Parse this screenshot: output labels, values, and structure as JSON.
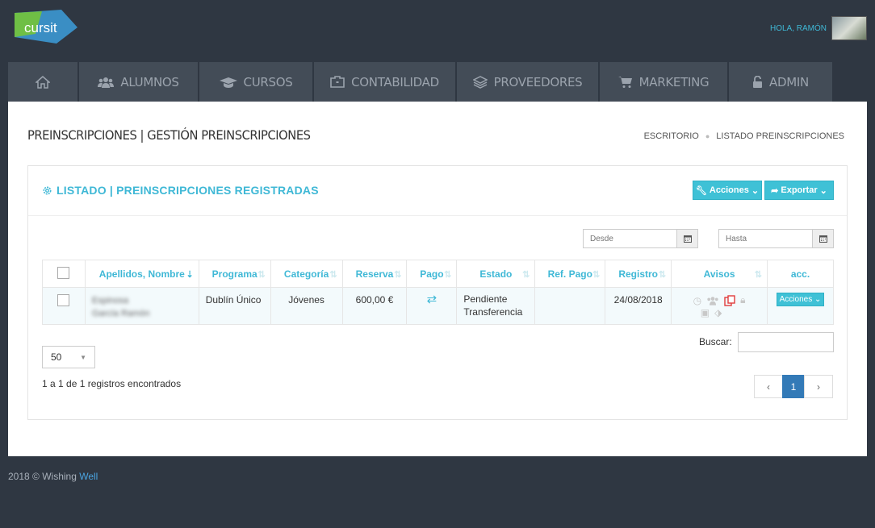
{
  "header": {
    "greeting": "HOLA, RAMÓN",
    "logo_text": "cursit"
  },
  "nav": [
    {
      "label": "",
      "icon": "home-icon"
    },
    {
      "label": "ALUMNOS",
      "icon": "users-icon"
    },
    {
      "label": "CURSOS",
      "icon": "graduation-cap-icon"
    },
    {
      "label": "CONTABILIDAD",
      "icon": "briefcase-icon"
    },
    {
      "label": "PROVEEDORES",
      "icon": "layers-icon"
    },
    {
      "label": "MARKETING",
      "icon": "cart-icon"
    },
    {
      "label": "ADMIN",
      "icon": "lock-icon"
    }
  ],
  "page": {
    "title": "PREINSCRIPCIONES | GESTIÓN PREINSCRIPCIONES",
    "breadcrumb": [
      "ESCRITORIO",
      "LISTADO PREINSCRIPCIONES"
    ]
  },
  "panel": {
    "title": "LISTADO | PREINSCRIPCIONES REGISTRADAS",
    "actions_label": "Acciones",
    "export_label": "Exportar"
  },
  "filters": {
    "from_placeholder": "Desde",
    "to_placeholder": "Hasta"
  },
  "table": {
    "headers": [
      "Apellidos, Nombre",
      "Programa",
      "Categoría",
      "Reserva",
      "Pago",
      "Estado",
      "Ref. Pago",
      "Registro",
      "Avisos",
      "acc."
    ],
    "rows": [
      {
        "name_line1": "Espinosa",
        "name_line2": "García Ramón",
        "programa": "Dublín Único",
        "categoria": "Jóvenes",
        "reserva": "600,00 €",
        "estado": "Pendiente Transferencia",
        "ref_pago": "",
        "registro": "24/08/2018",
        "acc_label": "Acciones"
      }
    ]
  },
  "pagination": {
    "page_size": "50",
    "found": "1 a 1 de 1 registros encontrados",
    "search_label": "Buscar:",
    "current_page": "1",
    "prev": "‹",
    "next": "›"
  },
  "footer": {
    "text": "2018 © Wishing ",
    "link": "Well"
  },
  "colors": {
    "accent": "#3fc1d6",
    "dark_bg": "#2f3742",
    "nav_bg": "#434c57",
    "page_active": "#337ab7"
  }
}
